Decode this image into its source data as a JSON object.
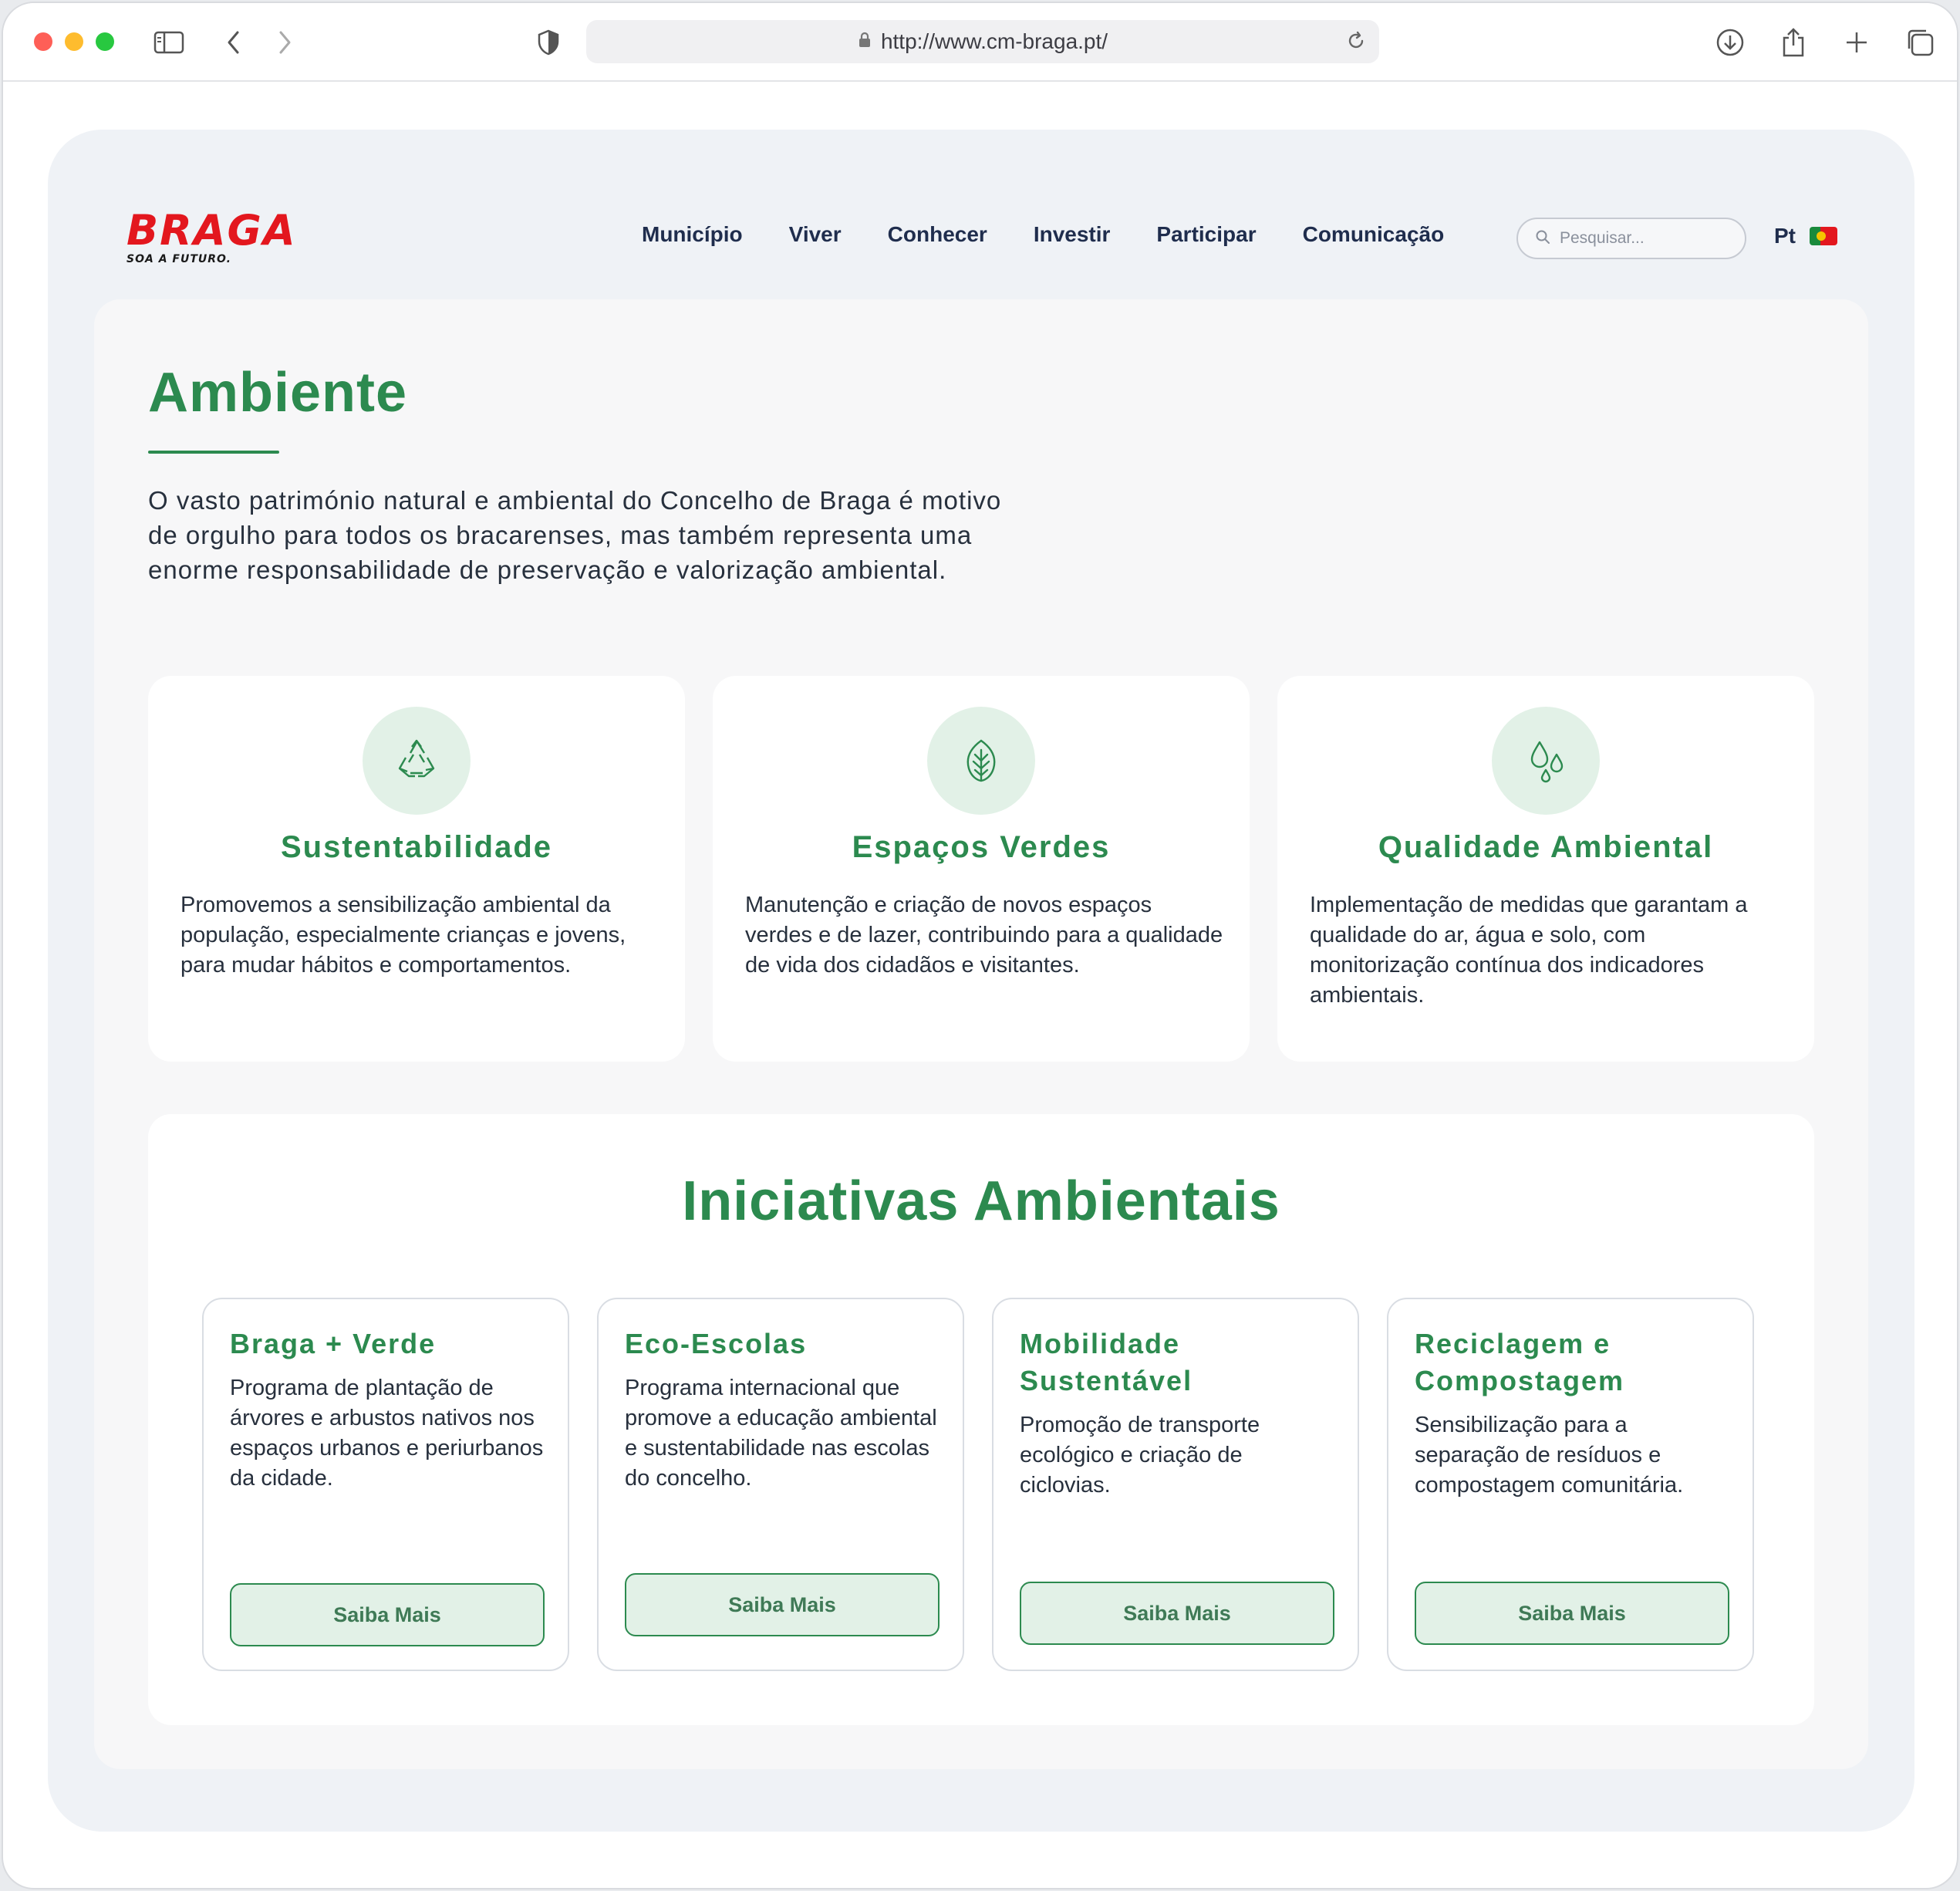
{
  "browser": {
    "url": "http://www.cm-braga.pt/"
  },
  "site": {
    "logo_text": "BRAGA",
    "logo_tagline": "SOA A FUTURO.",
    "nav": [
      "Município",
      "Viver",
      "Conhecer",
      "Investir",
      "Participar",
      "Comunicação"
    ],
    "search_placeholder": "Pesquisar...",
    "language": "Pt"
  },
  "main": {
    "title": "Ambiente",
    "intro": "O vasto património natural e ambiental do Concelho de Braga é motivo de orgulho para todos os bracarenses, mas também representa uma enorme responsabilidade de preservação e valorização ambiental.",
    "features": [
      {
        "icon": "recycle-icon",
        "title": "Sustentabilidade",
        "text": "Promovemos a sensibilização ambiental da população, especialmente crianças e jovens, para mudar hábitos e comportamentos."
      },
      {
        "icon": "leaf-icon",
        "title": "Espaços Verdes",
        "text": "Manutenção e criação de novos espaços verdes e de lazer, contribuindo para a qualidade de vida dos cidadãos e visitantes."
      },
      {
        "icon": "water-drops-icon",
        "title": "Qualidade Ambiental",
        "text": "Implementação de medidas que garantam a qualidade do ar, água e solo, com monitorização contínua dos indicadores ambientais."
      }
    ],
    "initiatives": {
      "title": "Iniciativas Ambientais",
      "cards": [
        {
          "title": "Braga + Verde",
          "text": "Programa de plantação de árvores e arbustos nativos nos espaços urbanos e periurbanos da cidade.",
          "button": "Saiba Mais"
        },
        {
          "title": "Eco-Escolas",
          "text": "Programa internacional que promove a educação ambiental e sustentabilidade nas escolas do concelho.",
          "button": "Saiba Mais"
        },
        {
          "title": "Mobilidade Sustentável",
          "text": "Promoção de transporte ecológico e criação de ciclovias.",
          "button": "Saiba Mais"
        },
        {
          "title": "Reciclagem e Compostagem",
          "text": "Sensibilização para a separação de resíduos e compostagem comunitária.",
          "button": "Saiba Mais"
        }
      ]
    }
  },
  "colors": {
    "brand_red": "#e3171e",
    "accent_green": "#2c8a4f",
    "nav_text": "#1f2d4d"
  }
}
